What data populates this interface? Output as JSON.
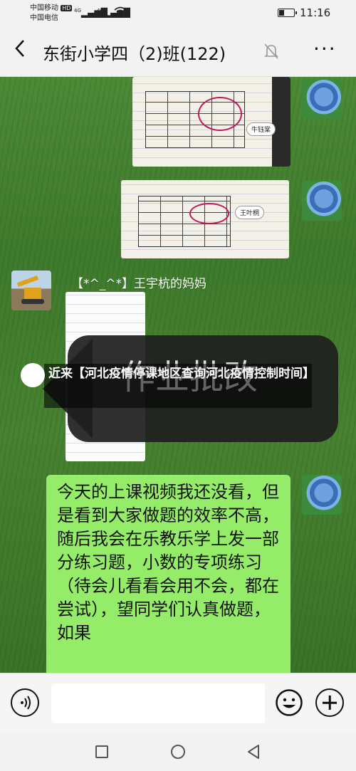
{
  "status_bar": {
    "carrier_1": "中国移动",
    "carrier_1_badge": "HD",
    "carrier_2": "中国电信",
    "network_1": "4G",
    "network_2": "4G",
    "battery_level": 0.35,
    "time": "11:16"
  },
  "header": {
    "back_icon": "chevron-left-icon",
    "title": "东街小学四（2)班(122)",
    "mute_icon": "bell-off-icon",
    "more_icon": "more-dots-icon",
    "more_label": "···"
  },
  "messages": [
    {
      "type": "image",
      "side": "right",
      "sticker": "牛钰棠",
      "avatar": "hydrangea"
    },
    {
      "type": "image",
      "side": "right",
      "sticker": "王叶桐",
      "avatar": "hydrangea"
    },
    {
      "type": "image",
      "side": "left",
      "sender": "【*^_^*】王宇杭的妈妈",
      "avatar": "excavator"
    },
    {
      "type": "text",
      "side": "right",
      "avatar": "hydrangea",
      "text": "今天的上课视频我还没看，但是看到大家做题的效率不高，随后我会在乐教乐学上发一部分练习题，小数的专项练习（待会儿看看会用不会，都在尝试），望同学们认真做题，如果"
    }
  ],
  "overlay": {
    "banner_text": "作业批改",
    "headline": "近来【河北疫情停课地区查询河北疫情控制时间】"
  },
  "input_bar": {
    "voice_icon": "voice-icon",
    "emoji_icon": "emoji-icon",
    "plus_icon": "plus-icon",
    "placeholder": ""
  },
  "nav_bar": {
    "recent_icon": "square-icon",
    "home_icon": "circle-icon",
    "back_icon": "triangle-back-icon"
  }
}
